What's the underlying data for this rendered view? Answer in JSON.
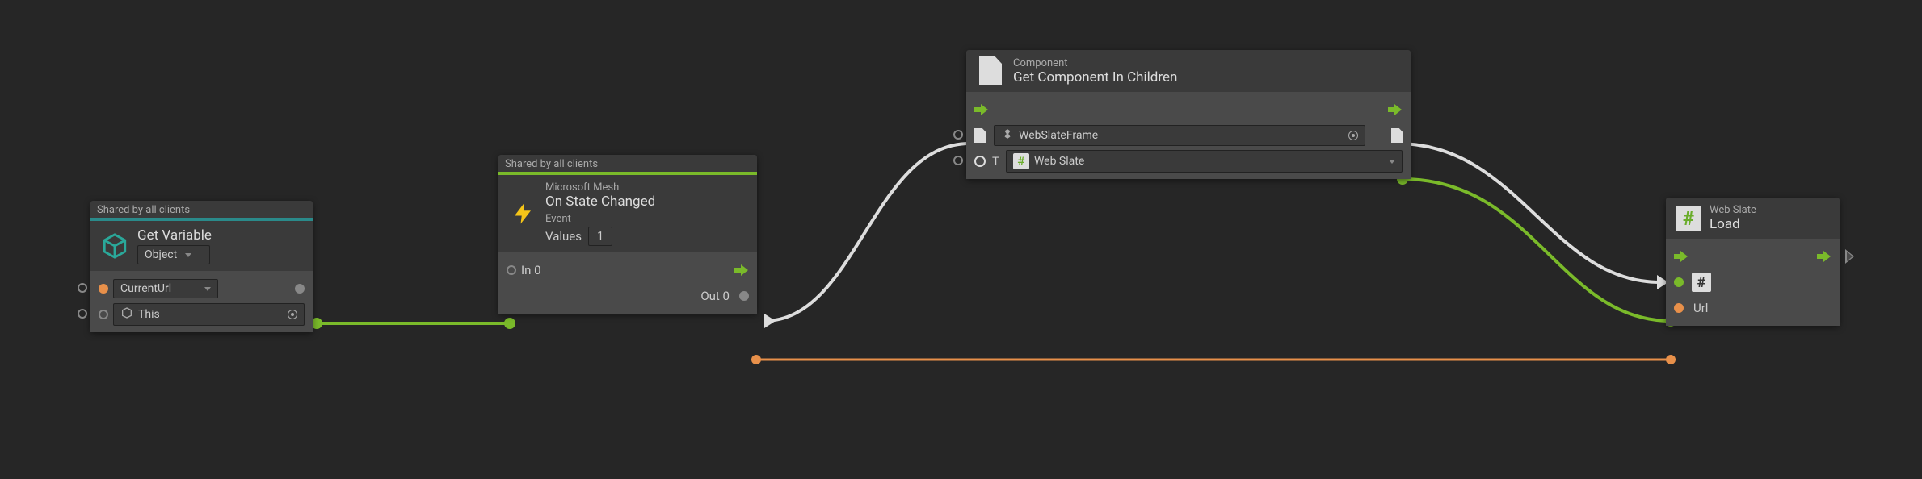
{
  "nodes": {
    "getVariable": {
      "supertitle": "Shared by all clients",
      "title": "Get Variable",
      "kindDropdown": "Object",
      "nameDropdown": "CurrentUrl",
      "targetField": "This"
    },
    "onStateChanged": {
      "supertitle": "Shared by all clients",
      "subtitle": "Microsoft Mesh",
      "title": "On State Changed",
      "eventLabel": "Event",
      "valuesLabel": "Values",
      "valuesCount": "1",
      "inLabel": "In 0",
      "outLabel": "Out 0"
    },
    "getComponent": {
      "subtitle": "Component",
      "title": "Get Component In Children",
      "objectField": "WebSlateFrame",
      "typePrefix": "T",
      "typeField": "Web Slate"
    },
    "webSlateLoad": {
      "subtitle": "Web Slate",
      "title": "Load",
      "urlLabel": "Url"
    }
  }
}
